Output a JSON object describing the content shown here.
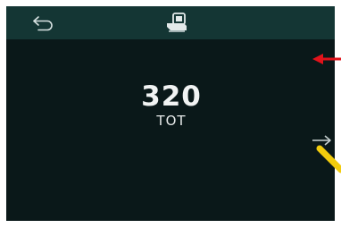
{
  "screen": {
    "main_value": "320",
    "unit": "TOT"
  },
  "icons": {
    "back": "back-arrow-icon",
    "cartridge": "cartridge-icon",
    "swipe": "right-arrow-icon"
  },
  "colors": {
    "background": "#0a1819",
    "topbar": "#143634",
    "text": "#f1f3f3",
    "annotation_arrow": "#e2131b",
    "annotation_pointer": "#f2cc0d"
  }
}
